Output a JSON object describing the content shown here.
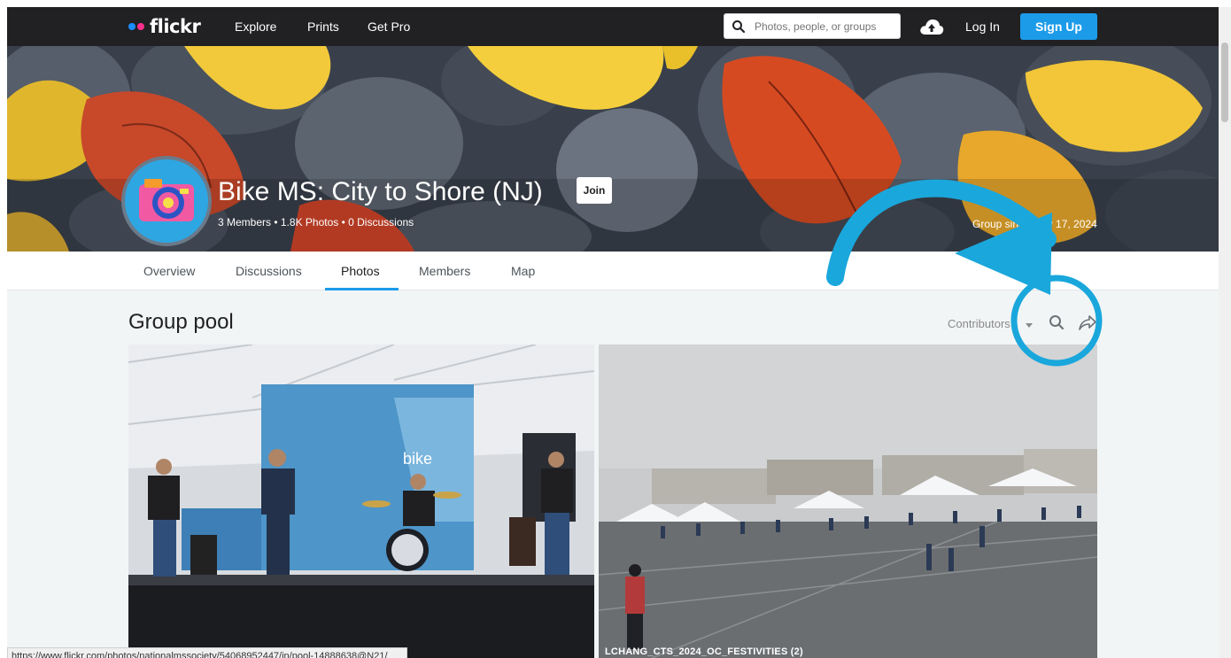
{
  "topnav": {
    "logo_text": "flickr",
    "links": [
      "Explore",
      "Prints",
      "Get Pro"
    ],
    "search_placeholder": "Photos, people, or groups",
    "login": "Log In",
    "signup": "Sign Up",
    "icons": [
      "search-icon",
      "upload-cloud-icon"
    ]
  },
  "group": {
    "title": "Bike MS: City to Shore (NJ)",
    "join": "Join",
    "stats": "3 Members  •  1.8K Photos  •  0 Discussions",
    "since": "Group since May 17, 2024"
  },
  "tabs": [
    "Overview",
    "Discussions",
    "Photos",
    "Members",
    "Map"
  ],
  "active_tab": "Photos",
  "pool": {
    "title": "Group pool",
    "sort_label": "Contributors",
    "icons": [
      "search-icon",
      "share-icon"
    ],
    "photos": [
      {
        "caption": ""
      },
      {
        "caption": "LCHANG_CTS_2024_OC_FESTIVITIES (2)"
      }
    ]
  },
  "status_url": "https://www.flickr.com/photos/nationalmssociety/54068952447/in/pool-14888638@N21/",
  "colors": {
    "nav_bg": "#212124",
    "accent": "#1c9be9",
    "annotation": "#1aa7dc"
  }
}
